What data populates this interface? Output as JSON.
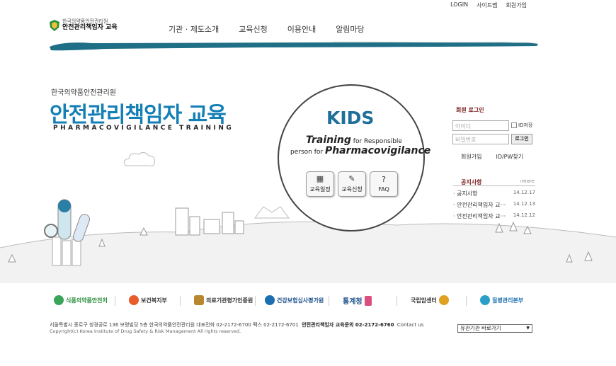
{
  "util": {
    "login": "LOGIN",
    "sitemap": "사이트맵",
    "join": "회원가입"
  },
  "logo": {
    "line1": "한국의약품안전관리원",
    "line2": "안전관리책임자 교육",
    "icon": "shield-logo-icon"
  },
  "nav": [
    "기관 · 제도소개",
    "교육신청",
    "이용안내",
    "알림마당"
  ],
  "hero": {
    "org": "한국의약품안전관리원",
    "title": "안전관리책임자 교육",
    "subtitle": "PHARMACOVIGILANCE TRAINING"
  },
  "kids": {
    "title": "KIDS",
    "line1_big": "Training",
    "line1_small": " for Responsible",
    "line2_small": "person for ",
    "line2_big": "Pharmacovigilance",
    "buttons": [
      {
        "label": "교육일정",
        "icon": "calendar-icon"
      },
      {
        "label": "교육신청",
        "icon": "pencil-icon"
      },
      {
        "label": "FAQ",
        "icon": "question-icon"
      }
    ]
  },
  "login": {
    "title": "회원 로그인",
    "id_placeholder": "아이디",
    "pw_placeholder": "비밀번호",
    "id_save": "ID저장",
    "button": "로그인",
    "join": "회원가입",
    "find": "ID/PW찾기"
  },
  "notice": {
    "title": "공지사항",
    "more": "›more",
    "items": [
      {
        "text": "· 공지사항",
        "date": "14.12.17"
      },
      {
        "text": "· 안전관리책임자 교···",
        "date": "14.12.13"
      },
      {
        "text": "· 안전관리책임자 교···",
        "date": "14.12.12"
      }
    ]
  },
  "partners": [
    "식품의약품안전처",
    "보건복지부",
    "의료기관평가인증원",
    "건강보험심사평가원",
    "통계청",
    "국립암센터",
    "질병관리본부"
  ],
  "footer": {
    "address": "서울특별시 종로구 창경궁로 136 보령빌딩 5층 한국의약품안전관리원  대표전화 02-2172-6700  팩스 02-2172-6701",
    "contact": "안전관리책임자 교육문의 02-2172-6760",
    "contact_us": "Contact us",
    "copyright": "Copyright(c) Korea Institute of Drug Safety & Risk Management  All rights reserved.",
    "related_site": "유관기관 바로가기"
  },
  "colors": {
    "brand_blue": "#137fb5",
    "kids_blue": "#1e6f99",
    "teal_stroke": "#1f6f86",
    "notice_red": "#7a1f1f"
  }
}
